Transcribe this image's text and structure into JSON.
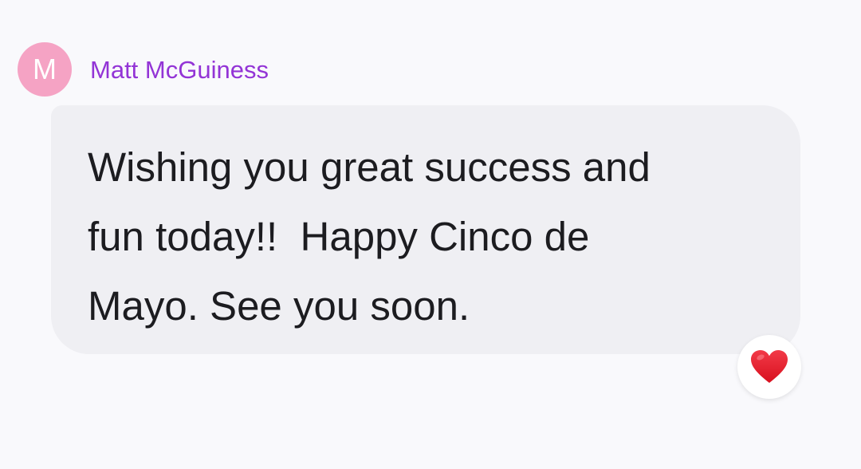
{
  "message": {
    "sender_initial": "M",
    "sender_name": "Matt McGuiness",
    "text_lines": [
      "Wishing you great success and",
      "fun today!!  Happy Cinco de",
      "Mayo. See you soon."
    ],
    "reaction_icon": "red-heart-icon"
  },
  "colors": {
    "avatar_bg": "#f5a3c4",
    "sender_name": "#9334d6",
    "bubble_bg": "#efeff3",
    "heart": "#e0182d"
  }
}
